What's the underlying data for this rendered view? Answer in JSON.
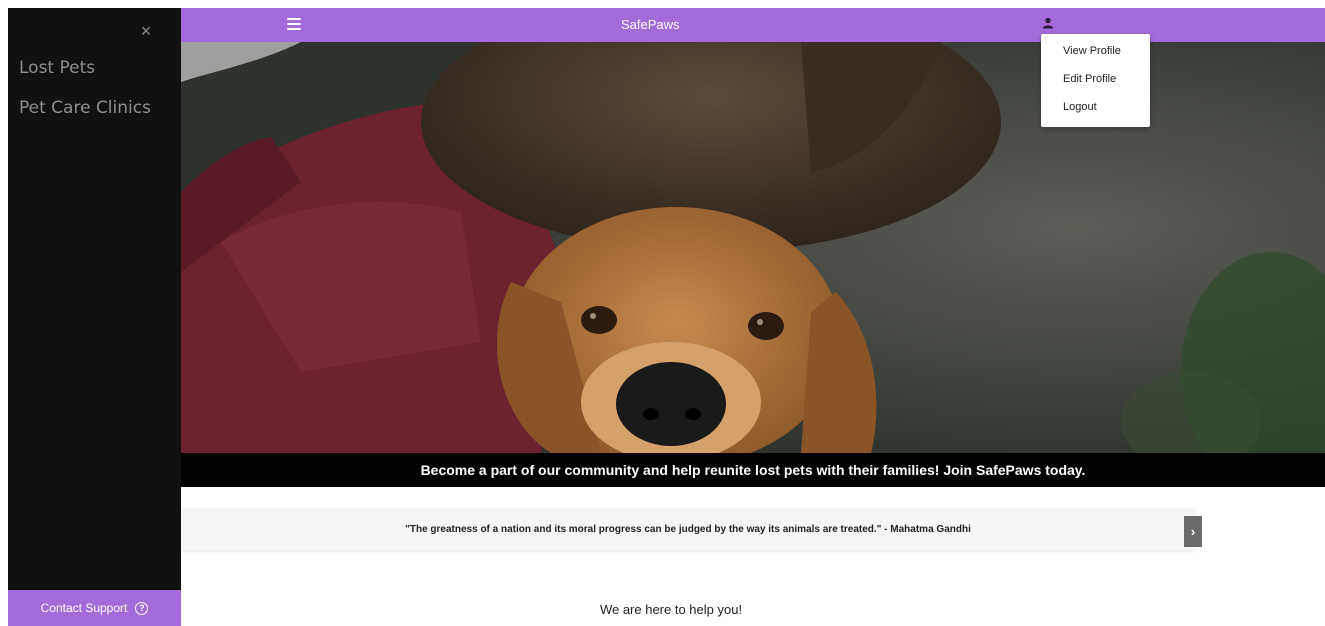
{
  "sidebar": {
    "close_glyph": "×",
    "items": [
      {
        "label": "Lost Pets"
      },
      {
        "label": "Pet Care Clinics"
      }
    ],
    "contact_label": "Contact Support",
    "help_glyph": "?"
  },
  "header": {
    "brand": "SafePaws"
  },
  "user_menu": {
    "items": [
      {
        "label": "View Profile"
      },
      {
        "label": "Edit Profile"
      },
      {
        "label": "Logout"
      }
    ]
  },
  "hero": {
    "caption": "Become a part of our community and help reunite lost pets with their families! Join SafePaws today."
  },
  "quote": {
    "text": "\"The greatness of a nation and its moral progress can be judged by the way its animals are treated.\" - Mahatma Gandhi",
    "next_glyph": "›"
  },
  "main": {
    "help_text": "We are here to help you!"
  },
  "colors": {
    "accent": "#a36bd9",
    "sidebar_bg": "#111111",
    "caption_bg": "#000000"
  },
  "icons": {
    "menu": "hamburger-icon",
    "user": "user-icon",
    "close": "close-icon",
    "help": "question-circle-icon",
    "next": "chevron-right-icon"
  }
}
